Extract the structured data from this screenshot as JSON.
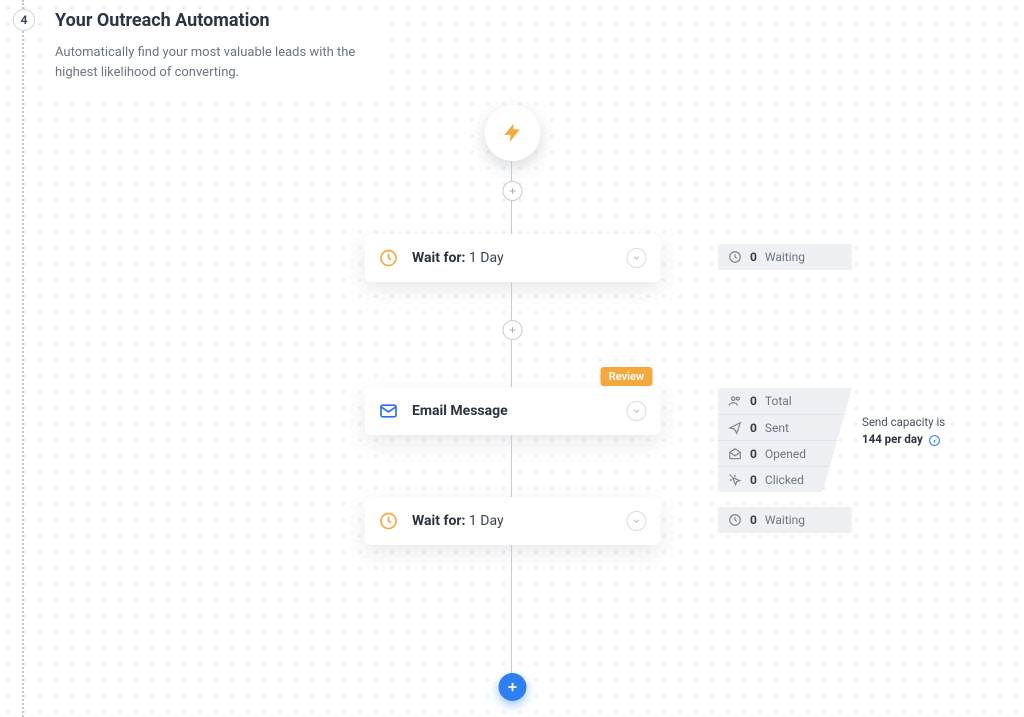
{
  "step_number": "4",
  "title": "Your Outreach Automation",
  "subtitle": "Automatically find your most valuable leads with the highest likelihood of converting.",
  "nodes": {
    "wait1": {
      "label_bold": "Wait for:",
      "label_rest": " 1 Day"
    },
    "email": {
      "label": "Email Message",
      "review_badge": "Review"
    },
    "wait2": {
      "label_bold": "Wait for:",
      "label_rest": " 1 Day"
    }
  },
  "stats": {
    "wait1": {
      "count": "0",
      "label": "Waiting"
    },
    "email": {
      "total": {
        "count": "0",
        "label": "Total"
      },
      "sent": {
        "count": "0",
        "label": "Sent"
      },
      "opened": {
        "count": "0",
        "label": "Opened"
      },
      "clicked": {
        "count": "0",
        "label": "Clicked"
      }
    },
    "wait2": {
      "count": "0",
      "label": "Waiting"
    }
  },
  "capacity": {
    "prefix": "Send capacity is",
    "value": "144 per day"
  }
}
